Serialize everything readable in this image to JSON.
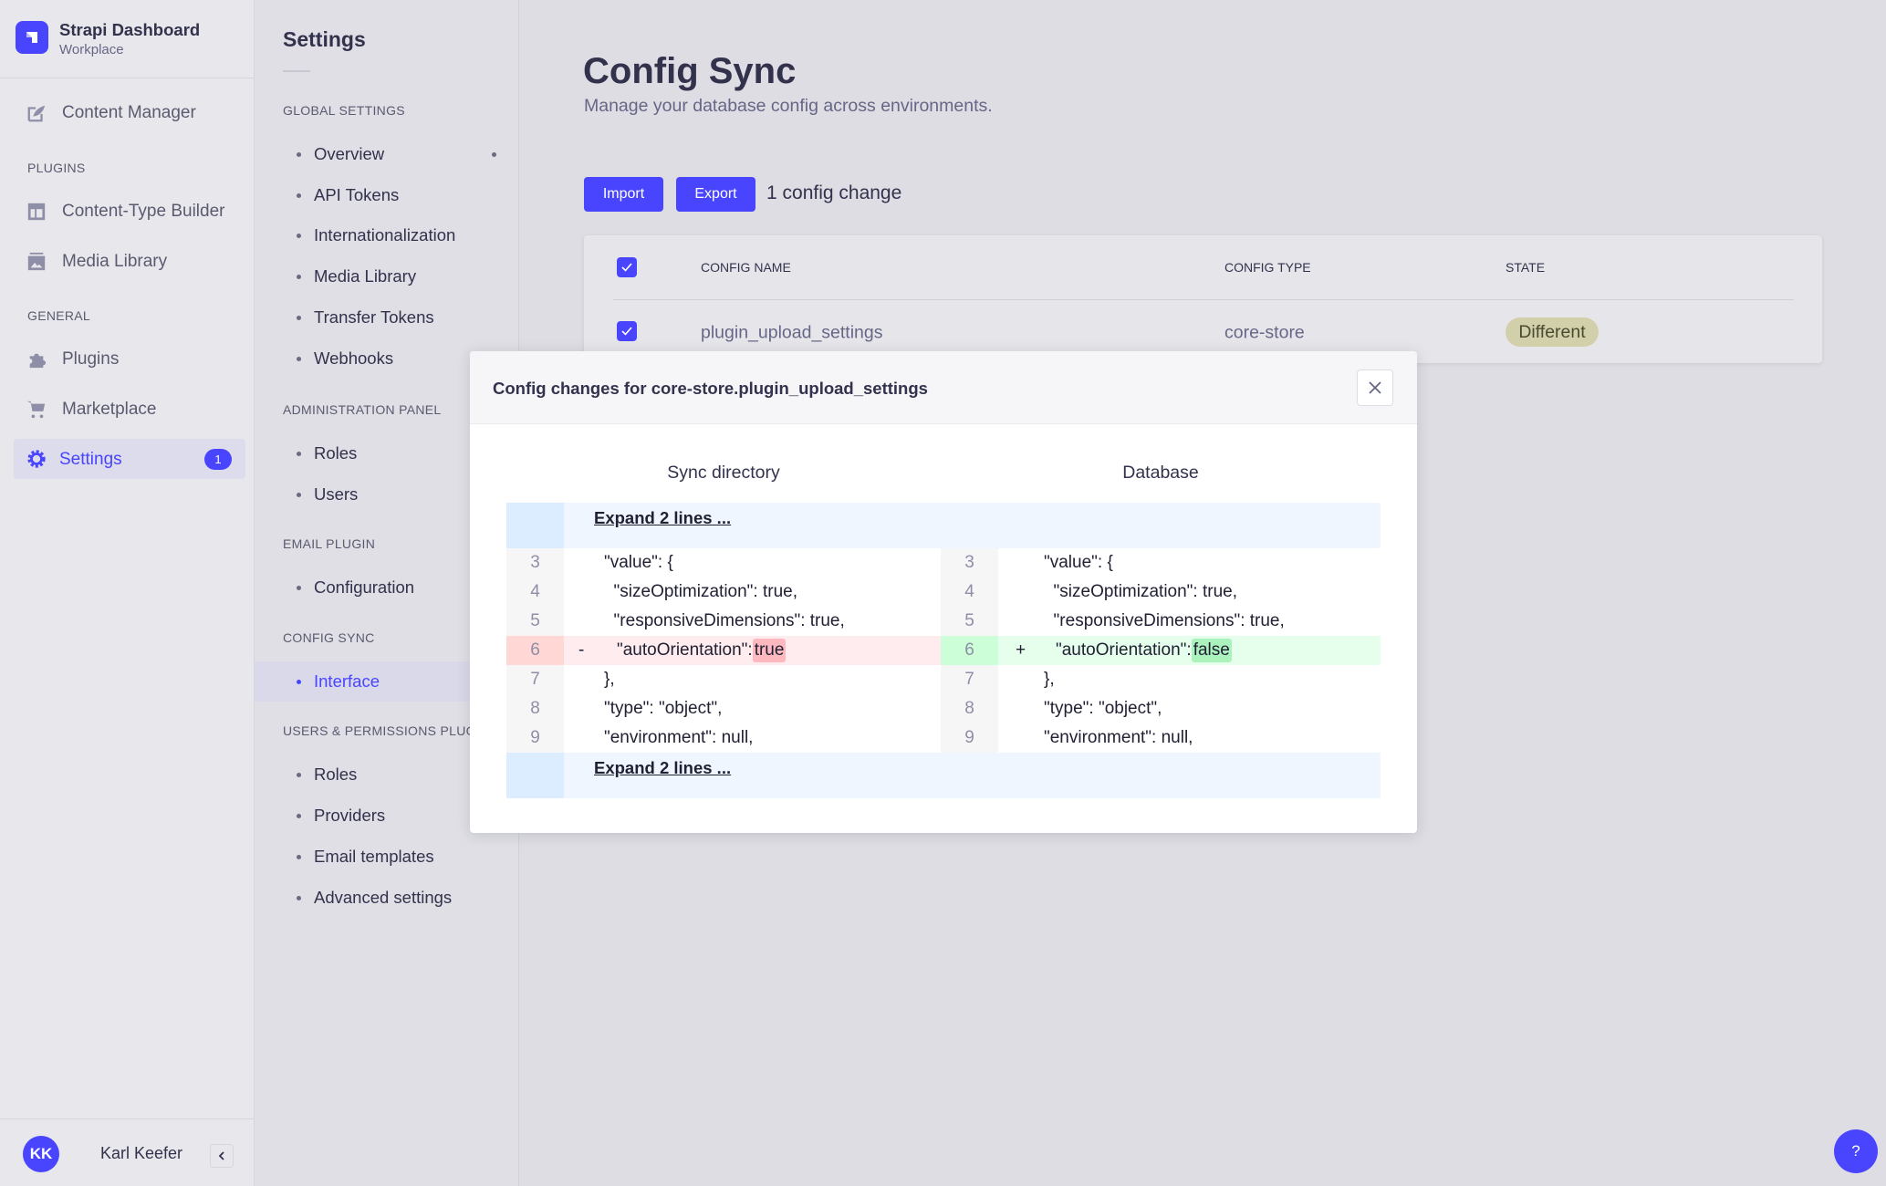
{
  "sidebar": {
    "app_title": "Strapi Dashboard",
    "workspace": "Workplace",
    "items": [
      {
        "label": "Content Manager",
        "icon": "feather-icon"
      }
    ],
    "sections": [
      {
        "title": "PLUGINS"
      },
      {
        "title": "GENERAL"
      }
    ],
    "plugins": [
      {
        "label": "Content-Type Builder",
        "icon": "layout-icon"
      },
      {
        "label": "Media Library",
        "icon": "image-icon"
      }
    ],
    "general": [
      {
        "label": "Plugins",
        "icon": "puzzle-icon"
      },
      {
        "label": "Marketplace",
        "icon": "cart-icon"
      },
      {
        "label": "Settings",
        "icon": "gear-icon",
        "badge": "1",
        "active": true
      }
    ],
    "user": {
      "initials": "KK",
      "name": "Karl Keefer"
    }
  },
  "settings": {
    "title": "Settings",
    "groups": [
      {
        "title": "GLOBAL SETTINGS",
        "items": [
          "Overview",
          "API Tokens",
          "Internationalization",
          "Media Library",
          "Transfer Tokens",
          "Webhooks"
        ]
      },
      {
        "title": "ADMINISTRATION PANEL",
        "items": [
          "Roles",
          "Users"
        ]
      },
      {
        "title": "EMAIL PLUGIN",
        "items": [
          "Configuration"
        ]
      },
      {
        "title": "CONFIG SYNC",
        "items": [
          "Interface"
        ]
      },
      {
        "title": "USERS & PERMISSIONS PLUGIN",
        "items": [
          "Roles",
          "Providers",
          "Email templates",
          "Advanced settings"
        ]
      }
    ]
  },
  "main": {
    "title": "Config Sync",
    "subtitle": "Manage your database config across environments.",
    "import_label": "Import",
    "export_label": "Export",
    "change_count": "1 config change",
    "table": {
      "headers": [
        "CONFIG NAME",
        "CONFIG TYPE",
        "STATE"
      ],
      "rows": [
        {
          "name": "plugin_upload_settings",
          "type": "core-store",
          "state": "Different",
          "checked": true
        }
      ]
    }
  },
  "modal": {
    "title": "Config changes for core-store.plugin_upload_settings",
    "left_title": "Sync directory",
    "right_title": "Database",
    "expand_label": "Expand 2 lines ...",
    "lines": [
      {
        "n": "3",
        "left": "\"value\": {",
        "right": "\"value\": {"
      },
      {
        "n": "4",
        "left": "  \"sizeOptimization\": true,",
        "right": "  \"sizeOptimization\": true,"
      },
      {
        "n": "5",
        "left": "  \"responsiveDimensions\": true,",
        "right": "  \"responsiveDimensions\": true,"
      },
      {
        "n": "6",
        "changed": true,
        "left_marker": "-",
        "right_marker": "+",
        "key": "\"autoOrientation\":",
        "left_value": "true",
        "right_value": "false"
      },
      {
        "n": "7",
        "left": "},",
        "right": "},"
      },
      {
        "n": "8",
        "left": "\"type\": \"object\",",
        "right": "\"type\": \"object\","
      },
      {
        "n": "9",
        "left": "\"environment\": null,",
        "right": "\"environment\": null,"
      }
    ]
  },
  "help": {
    "label": "?"
  },
  "colors": {
    "accent": "#4945ff",
    "removed_bg": "#ffecee",
    "removed_hl": "#fdb8c0",
    "added_bg": "#e6ffec",
    "added_hl": "#acf2bd",
    "badge": "#d2d0aa"
  }
}
